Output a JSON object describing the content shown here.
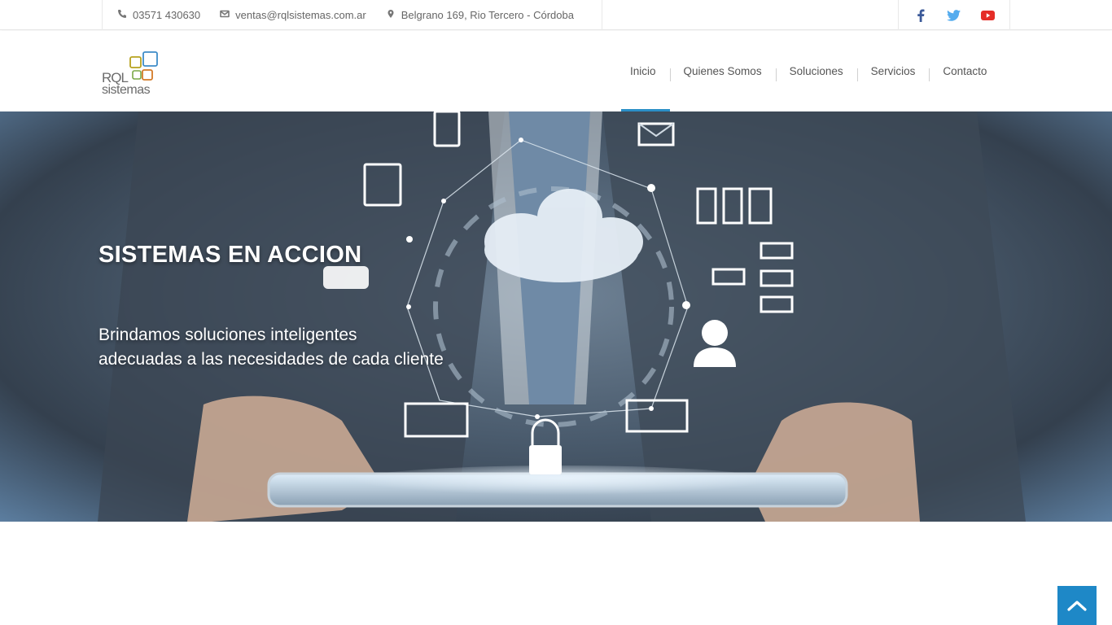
{
  "topbar": {
    "phone": "03571 430630",
    "email": "ventas@rqlsistemas.com.ar",
    "address": "Belgrano 169, Rio Tercero - Córdoba",
    "social": [
      "facebook-icon",
      "twitter-icon",
      "youtube-icon"
    ]
  },
  "brand": {
    "line1": "RQL",
    "line2": "sistemas"
  },
  "nav": {
    "items": [
      {
        "label": "Inicio",
        "active": true
      },
      {
        "label": "Quienes Somos"
      },
      {
        "label": "Soluciones"
      },
      {
        "label": "Servicios"
      },
      {
        "label": "Contacto"
      }
    ]
  },
  "hero": {
    "title": "SISTEMAS EN ACCION",
    "subtitle_line1": "Brindamos soluciones inteligentes",
    "subtitle_line2": "adecuadas a las necesidades de cada cliente"
  },
  "colors": {
    "accent": "#2b8fc7",
    "facebook": "#3b5998",
    "twitter": "#55acee",
    "youtube": "#e52d27",
    "totop": "#1e88c7"
  }
}
